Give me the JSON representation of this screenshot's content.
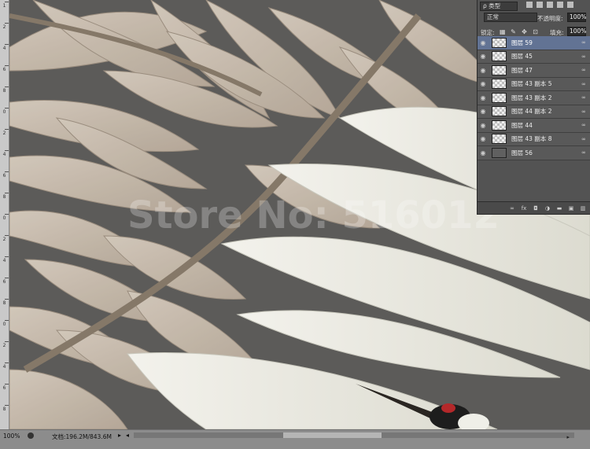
{
  "ruler": {
    "ticks": [
      "1",
      "2",
      "4",
      "6",
      "8",
      "0",
      "2",
      "4",
      "6",
      "8",
      "0",
      "2",
      "4",
      "6",
      "8",
      "0",
      "2",
      "4",
      "6",
      "8"
    ]
  },
  "layers_panel": {
    "filter_select": "ρ 类型",
    "blend_mode": "正常",
    "opacity_label": "不透明度:",
    "opacity_value": "100%",
    "lock_label": "锁定:",
    "fill_label": "填充:",
    "fill_value": "100%",
    "layers": [
      {
        "name": "图层 59",
        "selected": true
      },
      {
        "name": "图层 45"
      },
      {
        "name": "图层 47"
      },
      {
        "name": "图层 43 副本 5"
      },
      {
        "name": "图层 43 副本 2"
      },
      {
        "name": "图层 44 副本 2"
      },
      {
        "name": "图层 44"
      },
      {
        "name": "图层 43 副本 8"
      },
      {
        "name": "图层 56",
        "dark": true
      }
    ],
    "footer_icons": [
      "link-icon",
      "fx-icon",
      "mask-icon",
      "adjustment-icon",
      "group-icon",
      "new-layer-icon",
      "trash-icon"
    ]
  },
  "status_bar": {
    "zoom": "100%",
    "doc_info": "文档:196.2M/843.6M"
  },
  "watermark": "Store No: 516012",
  "colors": {
    "canvas_bg": "#5a5a59",
    "leaf": "#cfc3b4",
    "feather": "#ebeae2",
    "panel": "#535353",
    "selected_layer": "#627394"
  }
}
